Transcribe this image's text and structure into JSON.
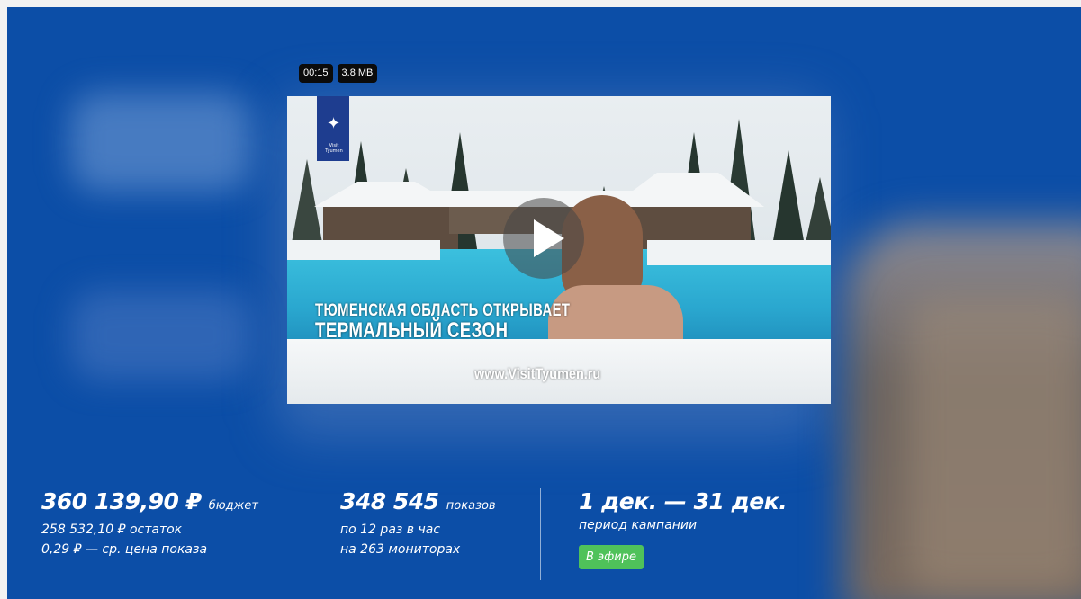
{
  "video": {
    "duration": "00:15",
    "size": "3.8 MB",
    "caption_line1": "ТЮМЕНСКАЯ ОБЛАСТЬ ОТКРЫВАЕТ",
    "caption_line2": "ТЕРМАЛЬНЫЙ СЕЗОН",
    "url": "www.VisitTyumen.ru",
    "logo_text": "Visit Tyumen"
  },
  "stats": {
    "budget": {
      "amount": "360 139,90 ₽",
      "amount_label": "бюджет",
      "remaining": "258 532,10 ₽ остаток",
      "avg_price": "0,29 ₽ — ср. цена показа"
    },
    "impressions": {
      "count": "348 545",
      "count_label": "показов",
      "frequency": "по 12 раз в час",
      "monitors": "на 263 мониторах"
    },
    "period": {
      "dates": "1 дек. — 31 дек.",
      "label": "период кампании",
      "status": "В эфире"
    }
  },
  "colors": {
    "background": "#0c4ea7",
    "status_live": "#4fc25a"
  }
}
